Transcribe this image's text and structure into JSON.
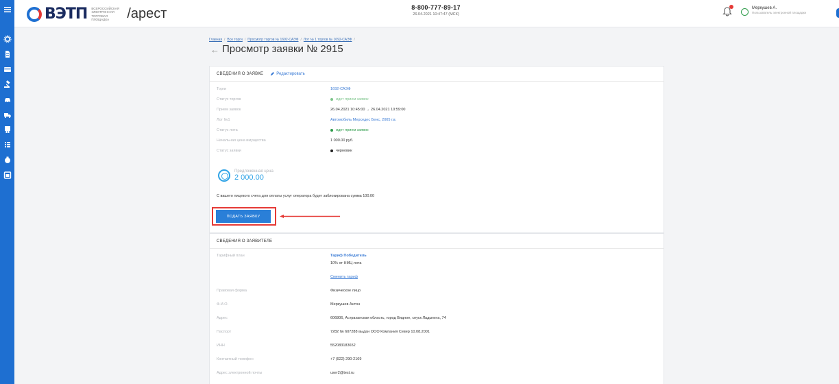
{
  "sidebar": {
    "icons": [
      "menu-icon",
      "gear-icon",
      "document-icon",
      "card-icon",
      "auction-icon",
      "car-icon",
      "truck-icon",
      "certificate-icon",
      "list-icon",
      "bag-icon",
      "calendar-icon"
    ]
  },
  "header": {
    "brand": "ВЭТП",
    "brand_sub": "всероссийская электронная торговая площадка",
    "brand_suffix": "/арест",
    "phone": "8-800-777-89-17",
    "datetime": "26.04.2021 10:47:47 (МСК)",
    "user_name": "Меркушев А.",
    "user_role": "Пользователь электронной площадки"
  },
  "breadcrumb": [
    "Главная",
    "Все торги",
    "Просмотр торгов № 1692-САЭФ",
    "Лот № 1 торгов № 1692-САЭФ"
  ],
  "page": {
    "back": "←",
    "title": "Просмотр заявки № 2915"
  },
  "application": {
    "section_title": "СВЕДЕНИЯ О ЗАЯВКЕ",
    "edit_label": "Редактировать",
    "rows": [
      {
        "label": "Торги",
        "value": "1692-САЭФ"
      },
      {
        "label": "Статус торгов",
        "value": "идет прием заявок"
      },
      {
        "label": "Прием заявок",
        "value": "26.04.2021 10:45:00 → 26.04.2021 10:59:00"
      },
      {
        "label": "Лот №1",
        "value": "Автомобиль Мерседес Бенс, 2005 г.в."
      },
      {
        "label": "Статус лота",
        "value": "идет прием заявок"
      },
      {
        "label": "Начальная цена имущества",
        "value": "1 000.00 руб."
      },
      {
        "label": "Статус заявки",
        "value": "черновик"
      }
    ],
    "price_label": "Предложенная цена",
    "price_value": "2 000.00",
    "notice": "С вашего лицевого счета для оплаты услуг оператора будет заблокирована сумма 100.00",
    "submit_label": "ПОДАТЬ ЗАЯВКУ"
  },
  "applicant": {
    "section_title": "СВЕДЕНИЯ О ЗАЯВИТЕЛЕ",
    "tariff_label": "Тарифный план",
    "tariff_name": "Тариф Победитель",
    "tariff_desc": "10% от НМЦ лота",
    "change_tariff": "Сменить тариф",
    "rows": [
      {
        "label": "Правовая форма",
        "value": "Физическое лицо"
      },
      {
        "label": "Ф.И.О.",
        "value": "Меркушев Антон"
      },
      {
        "label": "Адрес",
        "value": "606806, Астраханская область, город Видное, спуск Ладыгина, 74"
      },
      {
        "label": "Паспорт",
        "value": "7282 № 607288 выдан ООО Компания Север 10.08.2001"
      },
      {
        "label": "ИНН",
        "value": "552083183652"
      },
      {
        "label": "Контактный телефон",
        "value": "+7 (922) 290-2169"
      },
      {
        "label": "Адрес электронной почты",
        "value": "user2@test.ru"
      }
    ]
  },
  "colors": {
    "sidebar": "#1e6fd1",
    "accent": "#2a7fd8",
    "link": "#3a7bd5",
    "status_green": "#2e9c4b",
    "highlight_red": "#e53935",
    "price": "#2fa3e6"
  }
}
